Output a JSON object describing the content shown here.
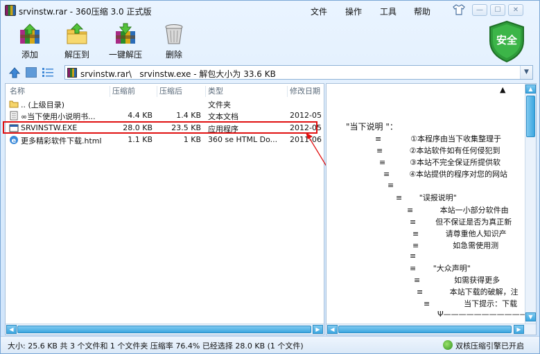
{
  "window": {
    "title": "srvinstw.rar - 360压缩 3.0 正式版",
    "menu": [
      "文件",
      "操作",
      "工具",
      "帮助"
    ],
    "controls": [
      "—",
      "☐",
      "✕"
    ]
  },
  "toolbar": {
    "add": "添加",
    "extract_to": "解压到",
    "one_click_extract": "一键解压",
    "delete": "删除",
    "security_badge": "安全"
  },
  "address": {
    "path": "srvinstw.rar\\   srvinstw.exe - 解包大小为 33.6 KB"
  },
  "file_list": {
    "columns": [
      "名称",
      "压缩前",
      "压缩后",
      "类型",
      "修改日期"
    ],
    "rows": [
      {
        "name": ".. (上级目录)",
        "packed": "",
        "size": "",
        "type": "文件夹",
        "date": ""
      },
      {
        "name": "∞当下使用小说明书...",
        "packed": "4.4 KB",
        "size": "1.4 KB",
        "type": "文本文档",
        "date": "2012-05"
      },
      {
        "name": "SRVINSTW.EXE",
        "packed": "28.0 KB",
        "size": "23.5 KB",
        "type": "应用程序",
        "date": "2012-05"
      },
      {
        "name": "更多精彩软件下载.html",
        "packed": "1.1 KB",
        "size": "1 KB",
        "type": "360 se HTML Do...",
        "date": "2011-06"
      }
    ]
  },
  "preview": {
    "lines": [
      "▲",
      "\"当下说明 \"：",
      "≡            ①本程序由当下收集整理于",
      "≡           ②本站软件如有任何侵犯到",
      "≡          ③本站不完全保证所提供软",
      "≡        ④本站提供的程序对您的网站",
      "≡",
      "≡       \"误报说明\"",
      "≡           本站一小部分软件由",
      "≡        但不保证是否为真正新",
      "≡           请尊重他人知识产",
      "≡              如急需使用测",
      "≡",
      "≡       \"大众声明\"",
      "≡              如需获得更多",
      "≡           本站下载的破解，注",
      "≡              当下提示：下载",
      "Ψ———————————"
    ]
  },
  "status": {
    "text": "大小: 25.6 KB 共 3 个文件和 1 个文件夹 压缩率 76.4% 已经选择 28.0 KB (1 个文件)",
    "engine": "双核压缩引擎已开启"
  },
  "colors": {
    "highlight_border": "#e01010",
    "annotation_arrow": "#e01010",
    "scroll_accent": "#3aa6e0",
    "shield_green": "#2e9b3a"
  }
}
